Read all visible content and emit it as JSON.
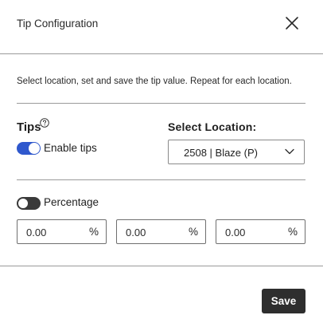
{
  "dialog": {
    "title": "Tip Configuration",
    "instructions": "Select location, set and save the tip value. Repeat for each location."
  },
  "tips": {
    "label": "Tips",
    "help_icon": "question-circle-icon",
    "enable_label": "Enable tips",
    "enabled": true
  },
  "location": {
    "label": "Select Location:",
    "selected": "2508 | Blaze (P)"
  },
  "percentage": {
    "label": "Percentage",
    "enabled": false,
    "fields": [
      {
        "value": "0.00",
        "unit": "%"
      },
      {
        "value": "0.00",
        "unit": "%"
      },
      {
        "value": "0.00",
        "unit": "%"
      }
    ]
  },
  "footer": {
    "save_label": "Save"
  },
  "colors": {
    "toggle_on": "#2f58cd",
    "toggle_off": "#3a3a3a",
    "save_button": "#2e2e2e"
  }
}
